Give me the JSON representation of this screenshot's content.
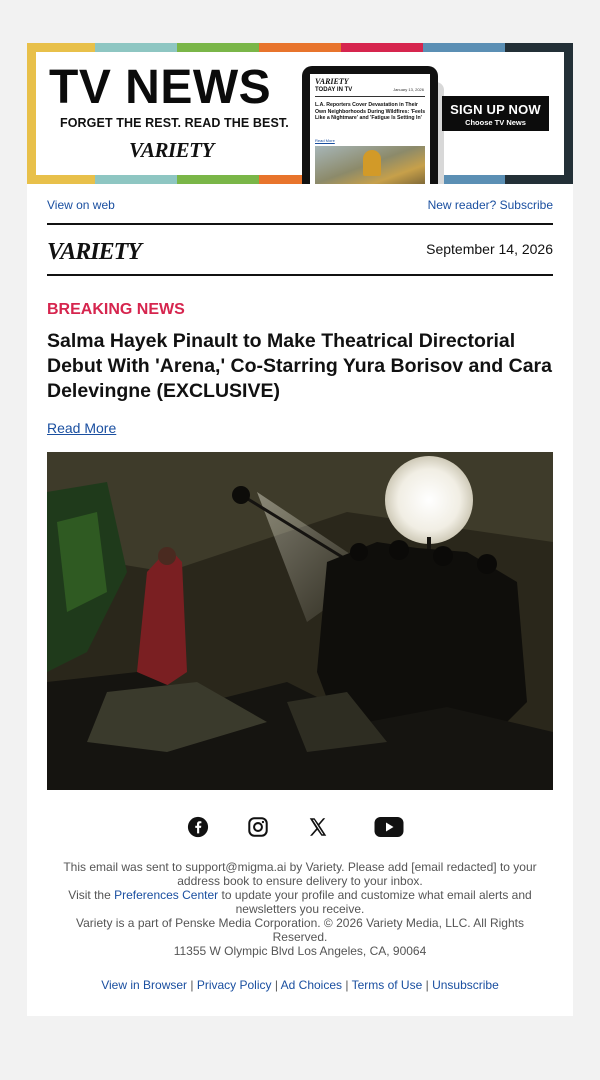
{
  "banner": {
    "title": "TV NEWS",
    "tagline": "FORGET THE REST. READ THE BEST.",
    "logo": "VARIETY",
    "phone": {
      "logo": "VARIETY",
      "label": "TODAY IN TV",
      "date": "January 13, 2026",
      "headline": "L.A. Reporters Cover Devastation in Their Own Neighborhoods During Wildfires: 'Feels Like a Nightmare' and 'Fatigue Is Setting In'",
      "read_more": "Read More"
    },
    "signup_main": "SIGN UP NOW",
    "signup_sub": "Choose TV News",
    "stripe_colors": [
      "#e8c04a",
      "#8ec6c2",
      "#7ab648",
      "#e8742c",
      "#d6254e",
      "#5b8fb4",
      "#233037"
    ]
  },
  "links": {
    "view_on_web": "View on web",
    "subscribe": "New reader? Subscribe"
  },
  "header": {
    "logo": "VARIETY",
    "date": "September 14, 2026"
  },
  "article": {
    "kicker": "BREAKING NEWS",
    "headline": "Salma Hayek Pinault to Make Theatrical Directorial Debut With 'Arena,' Co-Starring Yura Borisov and Cara Delevingne (EXCLUSIVE)",
    "read_more": "Read More",
    "image_icon": "film-set-photo"
  },
  "social": [
    {
      "name": "facebook-icon"
    },
    {
      "name": "instagram-icon"
    },
    {
      "name": "x-icon"
    },
    {
      "name": "youtube-icon"
    }
  ],
  "footer": {
    "line1": "This email was sent to support@migma.ai by Variety. Please add [email redacted] to your address book to ensure delivery to your inbox.",
    "line2_prefix": "Visit the ",
    "preferences_link": "Preferences Center",
    "line2_suffix": " to update your profile and customize what email alerts and newsletters you receive.",
    "line3": "Variety is a part of Penske Media Corporation. © 2026 Variety Media, LLC. All Rights Reserved.",
    "line4": "11355 W Olympic Blvd Los Angeles, CA, 90064",
    "links": [
      "View in Browser",
      "Privacy Policy",
      "Ad Choices",
      "Terms of Use",
      "Unsubscribe"
    ],
    "separator": " | "
  },
  "colors": {
    "accent_red": "#d6254e",
    "link_blue": "#1a4fa0"
  }
}
